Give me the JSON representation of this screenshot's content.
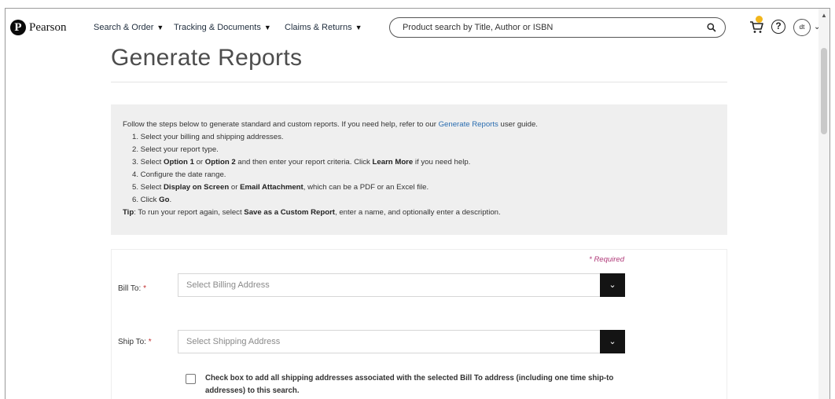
{
  "header": {
    "logo_text": "Pearson",
    "nav": [
      {
        "label": "Search & Order"
      },
      {
        "label": "Tracking & Documents"
      },
      {
        "label": "Claims & Returns"
      }
    ],
    "search_placeholder": "Product search by Title, Author or ISBN",
    "help_glyph": "?",
    "avatar_initials": "dt"
  },
  "page": {
    "title": "Generate Reports"
  },
  "instructions": {
    "intro_before": "Follow the steps below to generate standard and custom reports. If you need help, refer to our ",
    "intro_link": "Generate Reports",
    "intro_after": " user guide.",
    "step1": "1. Select your billing and shipping addresses.",
    "step2": "2. Select your report type.",
    "step3_a": "3. Select ",
    "step3_b": "Option 1",
    "step3_c": " or ",
    "step3_d": "Option 2",
    "step3_e": " and then enter your report criteria. Click ",
    "step3_f": "Learn More",
    "step3_g": " if you need help.",
    "step4": "4. Configure the date range.",
    "step5_a": "5. Select ",
    "step5_b": "Display on Screen",
    "step5_c": " or ",
    "step5_d": "Email Attachment",
    "step5_e": ", which can be a PDF or an Excel file.",
    "step6_a": "6. Click ",
    "step6_b": "Go",
    "step6_c": ".",
    "tip_label": "Tip",
    "tip_a": ": To run your report again, select ",
    "tip_b": "Save as a Custom Report",
    "tip_c": ", enter a name, and optionally enter a description."
  },
  "form": {
    "required_note": "* Required",
    "bill_to_label": "Bill To:",
    "bill_to_value": "Select Billing Address",
    "ship_to_label": "Ship To:",
    "ship_to_value": "Select Shipping Address",
    "required_star": "*",
    "include_all_label": "Check box to add all shipping addresses associated with the selected Bill To address (including one time ship-to addresses) to this search.",
    "include_all_checked": false
  },
  "colors": {
    "link": "#2a6db0",
    "cart_badge": "#f2b61b",
    "required": "#b03a79",
    "dropdown_button": "#141414"
  }
}
